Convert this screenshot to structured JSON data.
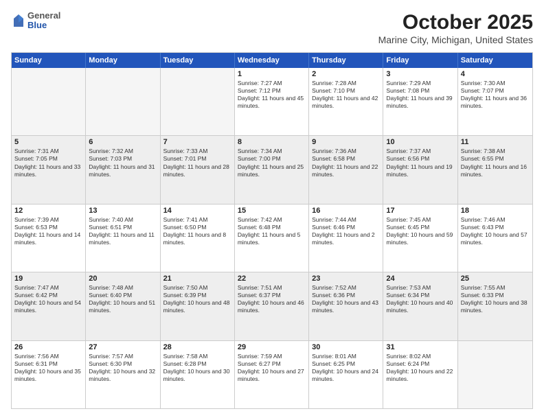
{
  "header": {
    "logo_general": "General",
    "logo_blue": "Blue",
    "month_title": "October 2025",
    "location": "Marine City, Michigan, United States"
  },
  "days_of_week": [
    "Sunday",
    "Monday",
    "Tuesday",
    "Wednesday",
    "Thursday",
    "Friday",
    "Saturday"
  ],
  "rows": [
    [
      {
        "day": "",
        "text": "",
        "empty": true
      },
      {
        "day": "",
        "text": "",
        "empty": true
      },
      {
        "day": "",
        "text": "",
        "empty": true
      },
      {
        "day": "1",
        "text": "Sunrise: 7:27 AM\nSunset: 7:12 PM\nDaylight: 11 hours and 45 minutes."
      },
      {
        "day": "2",
        "text": "Sunrise: 7:28 AM\nSunset: 7:10 PM\nDaylight: 11 hours and 42 minutes."
      },
      {
        "day": "3",
        "text": "Sunrise: 7:29 AM\nSunset: 7:08 PM\nDaylight: 11 hours and 39 minutes."
      },
      {
        "day": "4",
        "text": "Sunrise: 7:30 AM\nSunset: 7:07 PM\nDaylight: 11 hours and 36 minutes."
      }
    ],
    [
      {
        "day": "5",
        "text": "Sunrise: 7:31 AM\nSunset: 7:05 PM\nDaylight: 11 hours and 33 minutes.",
        "shaded": true
      },
      {
        "day": "6",
        "text": "Sunrise: 7:32 AM\nSunset: 7:03 PM\nDaylight: 11 hours and 31 minutes.",
        "shaded": true
      },
      {
        "day": "7",
        "text": "Sunrise: 7:33 AM\nSunset: 7:01 PM\nDaylight: 11 hours and 28 minutes.",
        "shaded": true
      },
      {
        "day": "8",
        "text": "Sunrise: 7:34 AM\nSunset: 7:00 PM\nDaylight: 11 hours and 25 minutes.",
        "shaded": true
      },
      {
        "day": "9",
        "text": "Sunrise: 7:36 AM\nSunset: 6:58 PM\nDaylight: 11 hours and 22 minutes.",
        "shaded": true
      },
      {
        "day": "10",
        "text": "Sunrise: 7:37 AM\nSunset: 6:56 PM\nDaylight: 11 hours and 19 minutes.",
        "shaded": true
      },
      {
        "day": "11",
        "text": "Sunrise: 7:38 AM\nSunset: 6:55 PM\nDaylight: 11 hours and 16 minutes.",
        "shaded": true
      }
    ],
    [
      {
        "day": "12",
        "text": "Sunrise: 7:39 AM\nSunset: 6:53 PM\nDaylight: 11 hours and 14 minutes."
      },
      {
        "day": "13",
        "text": "Sunrise: 7:40 AM\nSunset: 6:51 PM\nDaylight: 11 hours and 11 minutes."
      },
      {
        "day": "14",
        "text": "Sunrise: 7:41 AM\nSunset: 6:50 PM\nDaylight: 11 hours and 8 minutes."
      },
      {
        "day": "15",
        "text": "Sunrise: 7:42 AM\nSunset: 6:48 PM\nDaylight: 11 hours and 5 minutes."
      },
      {
        "day": "16",
        "text": "Sunrise: 7:44 AM\nSunset: 6:46 PM\nDaylight: 11 hours and 2 minutes."
      },
      {
        "day": "17",
        "text": "Sunrise: 7:45 AM\nSunset: 6:45 PM\nDaylight: 10 hours and 59 minutes."
      },
      {
        "day": "18",
        "text": "Sunrise: 7:46 AM\nSunset: 6:43 PM\nDaylight: 10 hours and 57 minutes."
      }
    ],
    [
      {
        "day": "19",
        "text": "Sunrise: 7:47 AM\nSunset: 6:42 PM\nDaylight: 10 hours and 54 minutes.",
        "shaded": true
      },
      {
        "day": "20",
        "text": "Sunrise: 7:48 AM\nSunset: 6:40 PM\nDaylight: 10 hours and 51 minutes.",
        "shaded": true
      },
      {
        "day": "21",
        "text": "Sunrise: 7:50 AM\nSunset: 6:39 PM\nDaylight: 10 hours and 48 minutes.",
        "shaded": true
      },
      {
        "day": "22",
        "text": "Sunrise: 7:51 AM\nSunset: 6:37 PM\nDaylight: 10 hours and 46 minutes.",
        "shaded": true
      },
      {
        "day": "23",
        "text": "Sunrise: 7:52 AM\nSunset: 6:36 PM\nDaylight: 10 hours and 43 minutes.",
        "shaded": true
      },
      {
        "day": "24",
        "text": "Sunrise: 7:53 AM\nSunset: 6:34 PM\nDaylight: 10 hours and 40 minutes.",
        "shaded": true
      },
      {
        "day": "25",
        "text": "Sunrise: 7:55 AM\nSunset: 6:33 PM\nDaylight: 10 hours and 38 minutes.",
        "shaded": true
      }
    ],
    [
      {
        "day": "26",
        "text": "Sunrise: 7:56 AM\nSunset: 6:31 PM\nDaylight: 10 hours and 35 minutes."
      },
      {
        "day": "27",
        "text": "Sunrise: 7:57 AM\nSunset: 6:30 PM\nDaylight: 10 hours and 32 minutes."
      },
      {
        "day": "28",
        "text": "Sunrise: 7:58 AM\nSunset: 6:28 PM\nDaylight: 10 hours and 30 minutes."
      },
      {
        "day": "29",
        "text": "Sunrise: 7:59 AM\nSunset: 6:27 PM\nDaylight: 10 hours and 27 minutes."
      },
      {
        "day": "30",
        "text": "Sunrise: 8:01 AM\nSunset: 6:25 PM\nDaylight: 10 hours and 24 minutes."
      },
      {
        "day": "31",
        "text": "Sunrise: 8:02 AM\nSunset: 6:24 PM\nDaylight: 10 hours and 22 minutes."
      },
      {
        "day": "",
        "text": "",
        "empty": true
      }
    ]
  ]
}
